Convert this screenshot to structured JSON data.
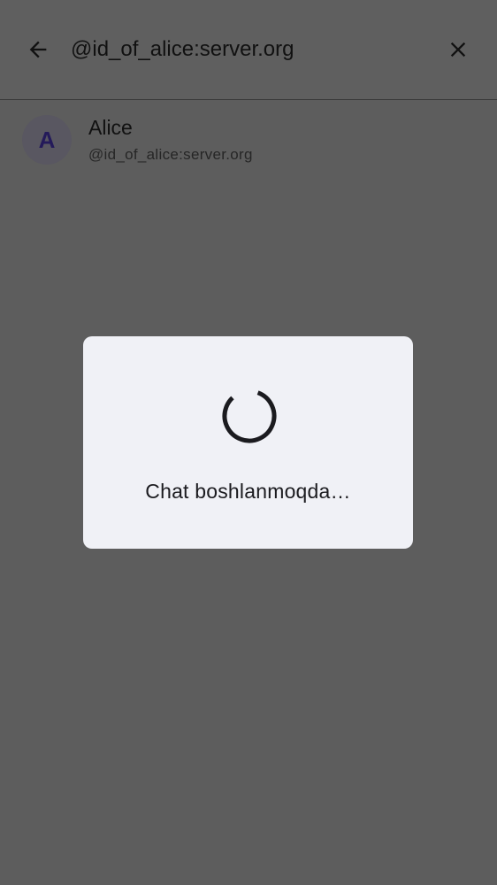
{
  "search": {
    "value": "@id_of_alice:server.org"
  },
  "icons": {
    "back": "arrow-back-icon",
    "close": "close-icon",
    "spinner": "loading-spinner"
  },
  "result": {
    "avatar_letter": "A",
    "name": "Alice",
    "user_id": "@id_of_alice:server.org"
  },
  "dialog": {
    "message": "Chat boshlanmoqda…"
  },
  "colors": {
    "scrim": "#5d5d5d",
    "dialog_background": "#f0f1f6",
    "avatar_text": "#241a5a"
  }
}
